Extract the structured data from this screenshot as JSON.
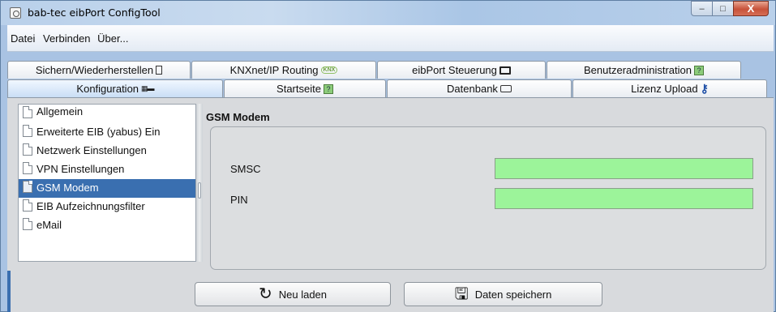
{
  "window": {
    "title": "bab-tec eibPort ConfigTool",
    "minimize": "–",
    "maximize": "□",
    "close": "X"
  },
  "menu": [
    "Datei",
    "Verbinden",
    "Über..."
  ],
  "tabs_row1": [
    {
      "label": "Sichern/Wiederherstellen",
      "icon": "document-icon"
    },
    {
      "label": "KNXnet/IP Routing",
      "icon": "knx-icon",
      "icon_text": "KNX"
    },
    {
      "label": "eibPort Steuerung",
      "icon": "monitor-icon"
    },
    {
      "label": "Benutzeradministration",
      "icon": "user-admin-icon"
    }
  ],
  "tabs_row2": [
    {
      "label": "Konfiguration",
      "icon": "config-icon",
      "active": true
    },
    {
      "label": "Startseite",
      "icon": "start-icon"
    },
    {
      "label": "Datenbank",
      "icon": "database-icon"
    },
    {
      "label": "Lizenz Upload",
      "icon": "key-icon"
    }
  ],
  "tree": {
    "items": [
      {
        "label": "Allgemein",
        "selected": false
      },
      {
        "label": "Erweiterte EIB (yabus) Ein",
        "selected": false
      },
      {
        "label": "Netzwerk Einstellungen",
        "selected": false
      },
      {
        "label": "VPN Einstellungen",
        "selected": false
      },
      {
        "label": "GSM Modem",
        "selected": true
      },
      {
        "label": "EIB Aufzeichnungsfilter",
        "selected": false
      },
      {
        "label": "eMail",
        "selected": false
      }
    ]
  },
  "gsm": {
    "title": "GSM Modem",
    "smsc_label": "SMSC",
    "smsc_value": "",
    "pin_label": "PIN",
    "pin_value": ""
  },
  "buttons": {
    "reload_label": "Neu laden",
    "save_label": "Daten speichern"
  },
  "colors": {
    "input_bg": "#9cf49a",
    "selection": "#3a6fb0"
  }
}
